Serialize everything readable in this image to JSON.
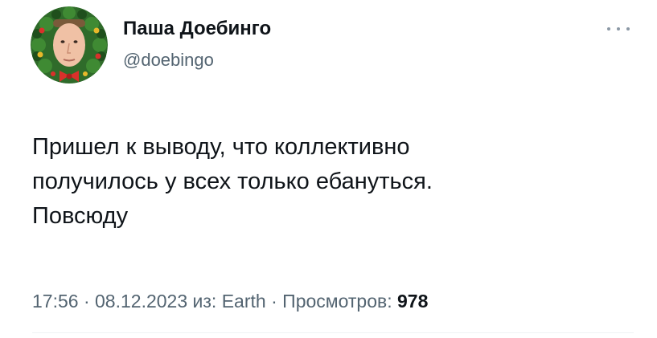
{
  "author": {
    "display_name": "Паша Доебинго",
    "handle": "@doebingo"
  },
  "tweet": {
    "text_lines": [
      "Пришел к выводу, что коллективно",
      "получилось у всех только ебануться.",
      "Повсюду"
    ]
  },
  "meta": {
    "time": "17:56",
    "separator": " · ",
    "date": "08.12.2023",
    "source_prefix": "из: ",
    "source": "Earth",
    "views_label": "Просмотров: ",
    "views_count": "978"
  },
  "icons": {
    "more": "more-horizontal-icon",
    "avatar_frame": "christmas-wreath"
  },
  "colors": {
    "text_primary": "#0f1419",
    "text_secondary": "#536471",
    "divider": "#eff3f4"
  }
}
